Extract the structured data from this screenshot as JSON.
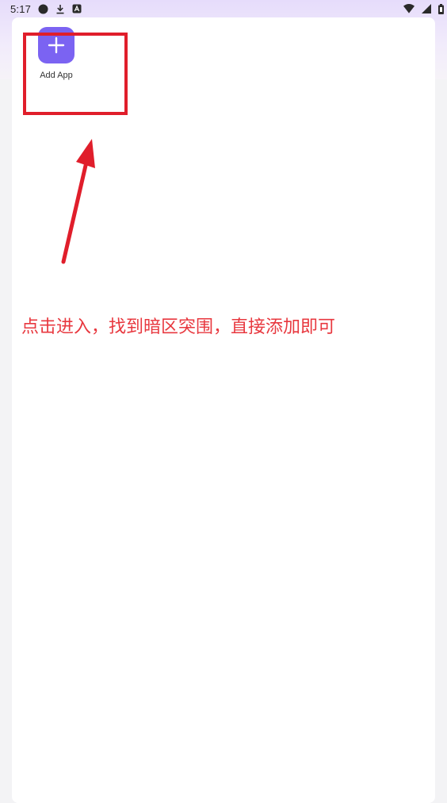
{
  "status_bar": {
    "time": "5:17",
    "left_icons": [
      "circle-icon",
      "download-icon",
      "notification-a-icon"
    ],
    "right_icons": [
      "wifi-icon",
      "signal-icon",
      "battery-icon"
    ]
  },
  "add_app": {
    "label": "Add App",
    "icon": "plus-icon",
    "tile_color": "#7b63f2"
  },
  "annotation": {
    "instruction_text": "点击进入，找到暗区突围，直接添加即可",
    "highlight_color": "#e01e2b",
    "text_color": "#e8383f"
  }
}
